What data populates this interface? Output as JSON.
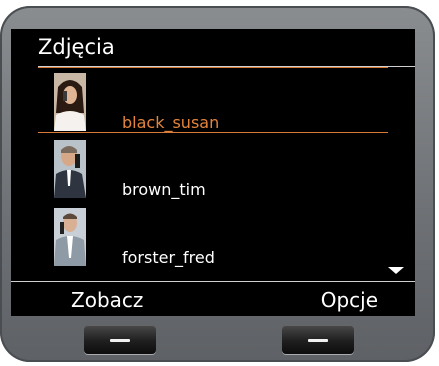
{
  "screen": {
    "title": "Zdjęcia",
    "items": [
      {
        "name": "black_susan",
        "selected": true,
        "avatar": "person-photo-icon"
      },
      {
        "name": "brown_tim",
        "selected": false,
        "avatar": "person-photo-icon"
      },
      {
        "name": "forster_fred",
        "selected": false,
        "avatar": "person-photo-icon"
      }
    ]
  },
  "softkeys": {
    "left": "Zobacz",
    "right": "Opcje"
  },
  "colors": {
    "accent": "#e4843c",
    "screen_bg": "#000000",
    "bezel": "#6d7074"
  }
}
